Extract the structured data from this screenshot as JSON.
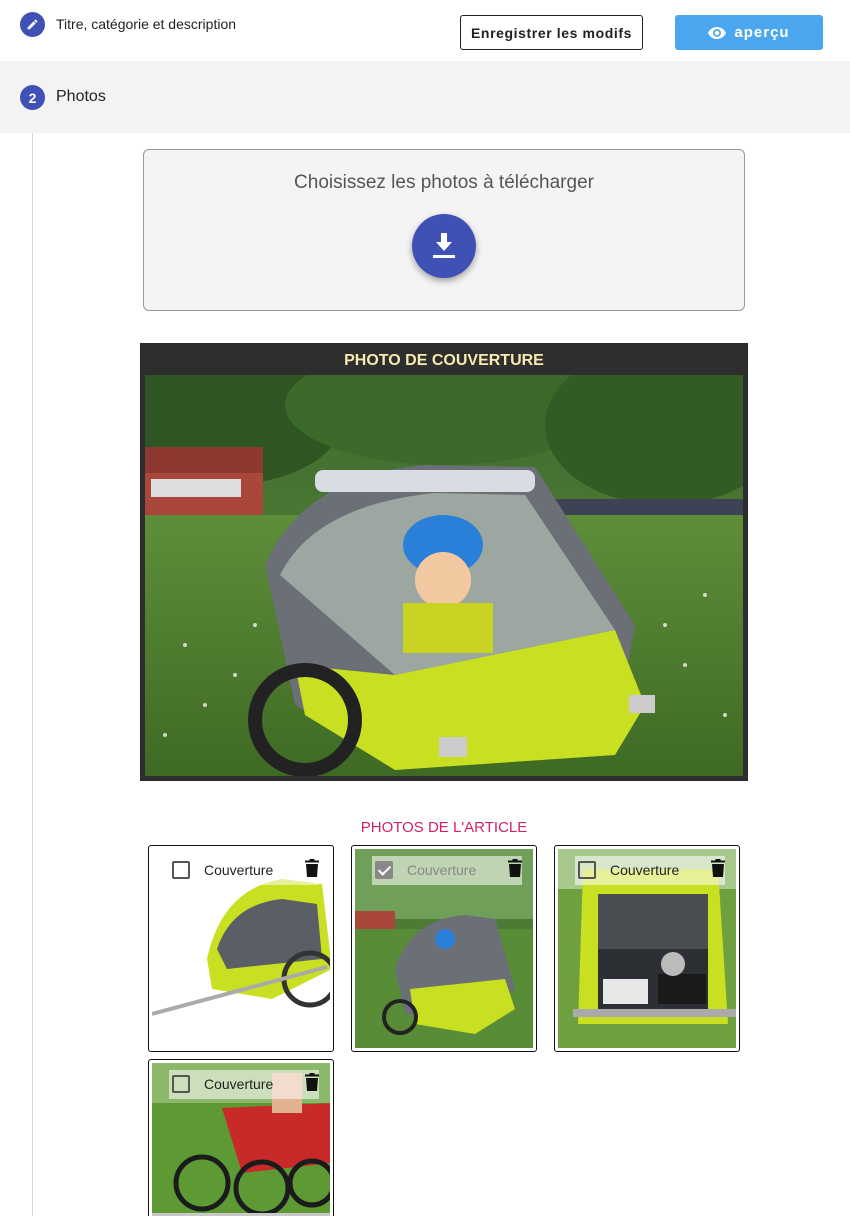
{
  "steps": [
    {
      "number": "",
      "icon": "pencil-icon",
      "title": "Titre, catégorie et description"
    },
    {
      "number": "2",
      "title": "Photos"
    }
  ],
  "toolbar": {
    "save_label": "Enregistrer les modifs",
    "preview_label": "aperçu"
  },
  "upload": {
    "title": "Choisissez les photos à télécharger",
    "icon": "download-icon"
  },
  "cover": {
    "title": "PHOTO DE COUVERTURE"
  },
  "article_photos": {
    "title": "PHOTOS DE L'ARTICLE",
    "items": [
      {
        "caption": "Couverture",
        "checked": false
      },
      {
        "caption": "Couverture",
        "checked": true
      },
      {
        "caption": "Couverture",
        "checked": false
      },
      {
        "caption": "Couverture",
        "checked": false
      }
    ]
  },
  "colors": {
    "primary": "#3f51b5",
    "preview_button": "#4aa7ef",
    "cover_title": "#f7e9b0",
    "section_title": "#d0216e",
    "trailer_yellow": "#c8e021"
  }
}
